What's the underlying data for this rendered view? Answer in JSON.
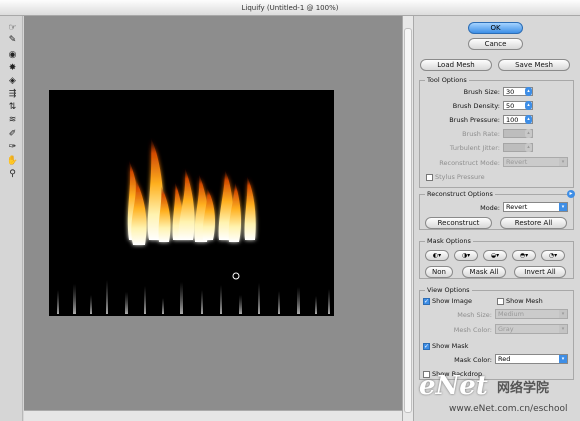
{
  "window": {
    "title": "Liquify (Untitled-1 @ 100%)"
  },
  "tools": [
    {
      "name": "forward-warp-tool-icon",
      "glyph": "☞"
    },
    {
      "name": "reconstruct-tool-icon",
      "glyph": "✎"
    },
    {
      "name": "twirl-clockwise-tool-icon",
      "glyph": "◉"
    },
    {
      "name": "pucker-tool-icon",
      "glyph": "✸"
    },
    {
      "name": "bloat-tool-icon",
      "glyph": "◈"
    },
    {
      "name": "push-left-tool-icon",
      "glyph": "⇶"
    },
    {
      "name": "mirror-tool-icon",
      "glyph": "⇅"
    },
    {
      "name": "turbulence-tool-icon",
      "glyph": "≋"
    },
    {
      "name": "freeze-mask-tool-icon",
      "glyph": "✐"
    },
    {
      "name": "thaw-mask-tool-icon",
      "glyph": "✑"
    },
    {
      "name": "hand-tool-icon",
      "glyph": "✋"
    },
    {
      "name": "zoom-tool-icon",
      "glyph": "⚲"
    }
  ],
  "buttons": {
    "ok": "OK",
    "cancel": "Cance",
    "load_mesh": "Load Mesh",
    "save_mesh": "Save Mesh"
  },
  "tool_options": {
    "title": "Tool Options",
    "brush_size_label": "Brush Size:",
    "brush_size": "30",
    "brush_density_label": "Brush Density:",
    "brush_density": "50",
    "brush_pressure_label": "Brush Pressure:",
    "brush_pressure": "100",
    "brush_rate_label": "Brush Rate:",
    "brush_rate": "",
    "turbulent_jitter_label": "Turbulent Jitter:",
    "turbulent_jitter": "",
    "reconstruct_mode_label": "Reconstruct Mode:",
    "reconstruct_mode": "Revert",
    "stylus_pressure": "Stylus Pressure"
  },
  "reconstruct_options": {
    "title": "Reconstruct Options",
    "mode_label": "Mode:",
    "mode": "Revert",
    "reconstruct": "Reconstruct",
    "restore_all": "Restore All"
  },
  "mask_options": {
    "title": "Mask Options",
    "none": "Non",
    "mask_all": "Mask All",
    "invert_all": "Invert All"
  },
  "view_options": {
    "title": "View Options",
    "show_image": "Show Image",
    "show_mesh": "Show Mesh",
    "mesh_size_label": "Mesh Size:",
    "mesh_size": "Medium",
    "mesh_color_label": "Mesh Color:",
    "mesh_color": "Gray",
    "show_mask": "Show Mask",
    "mask_color_label": "Mask Color:",
    "mask_color": "Red",
    "show_backdrop": "Show Backdrop"
  },
  "watermark": {
    "logo": "eNet",
    "chinese": "网络学院",
    "url": "www.eNet.com.cn/eschool"
  }
}
